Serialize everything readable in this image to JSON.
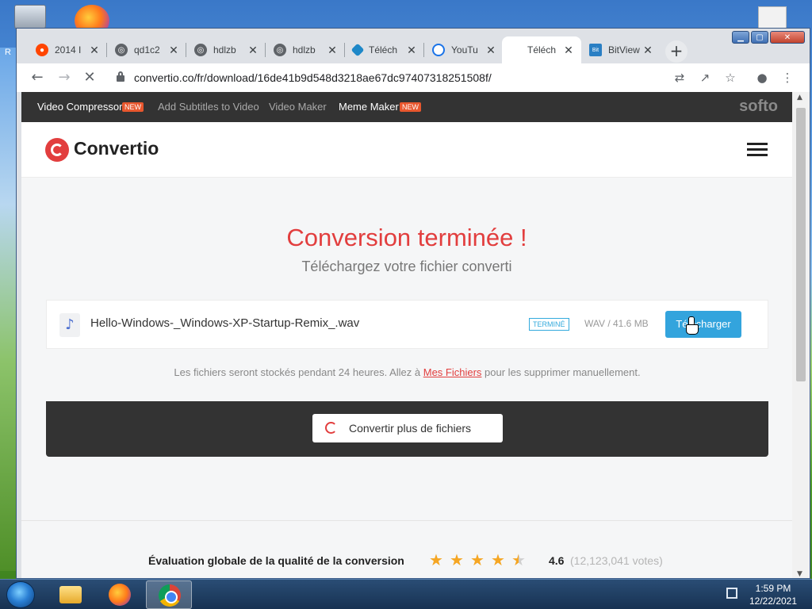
{
  "desktop": {
    "left_text": "R"
  },
  "browser": {
    "tabs": [
      {
        "title": "2014 I",
        "favicon": "reddit-icon"
      },
      {
        "title": "qd1c2",
        "favicon": "globe-icon"
      },
      {
        "title": "hdlzb",
        "favicon": "globe-icon"
      },
      {
        "title": "hdlzb",
        "favicon": "globe-icon"
      },
      {
        "title": "Téléch",
        "favicon": "diamond-icon"
      },
      {
        "title": "YouTu",
        "favicon": "cloud-download-icon"
      },
      {
        "title": "Téléch",
        "favicon": "blank-icon"
      },
      {
        "title": "BitView",
        "favicon": "bitview-icon"
      }
    ],
    "new_tab_label": "+",
    "url": "convertio.co/fr/download/16de41b9d548d3218ae67dc97407318251508f/"
  },
  "site_nav": {
    "items": [
      {
        "label": "Video Compressor",
        "badge": "NEW"
      },
      {
        "label": "Add Subtitles to Video",
        "badge": ""
      },
      {
        "label": "Video Maker",
        "badge": ""
      },
      {
        "label": "Meme Maker",
        "badge": "NEW"
      }
    ],
    "brand": "softo"
  },
  "header": {
    "logo_text": "Convertio"
  },
  "main": {
    "title": "Conversion terminée !",
    "subtitle": "Téléchargez votre fichier converti",
    "file": {
      "name": "Hello-Windows-_Windows-XP-Startup-Remix_.wav",
      "status": "TERMINÉ",
      "meta": "WAV / 41.6 MB",
      "download_label": "Télécharger"
    },
    "info": {
      "before": "Les fichiers seront stockés pendant 24 heures. Allez à ",
      "link": "Mes Fichiers",
      "after": " pour les supprimer manuellement."
    },
    "convert_more_label": "Convertir plus de fichiers"
  },
  "rating": {
    "label": "Évaluation globale de la qualité de la conversion",
    "score": "4.6",
    "stars": 4.5,
    "votes": "(12,123,041 votes)"
  },
  "taskbar": {
    "time": "1:59 PM",
    "date": "12/22/2021"
  },
  "colors": {
    "accent_red": "#e23e3e",
    "download_blue": "#33a4dd",
    "nav_dark": "#333333",
    "star": "#f5a623"
  }
}
